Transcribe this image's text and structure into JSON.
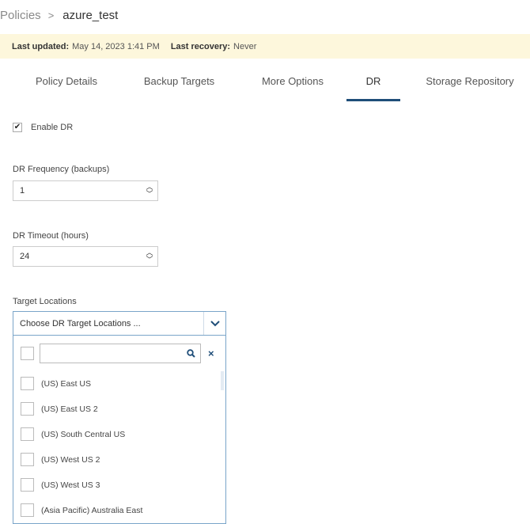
{
  "breadcrumb": {
    "parent": "Policies",
    "separator": ">",
    "current": "azure_test"
  },
  "banner": {
    "last_updated_label": "Last updated:",
    "last_updated_value": "May 14, 2023 1:41 PM",
    "last_recovery_label": "Last recovery:",
    "last_recovery_value": "Never"
  },
  "tabs": [
    {
      "label": "Policy Details",
      "active": false
    },
    {
      "label": "Backup Targets",
      "active": false
    },
    {
      "label": "More Options",
      "active": false
    },
    {
      "label": "DR",
      "active": true
    },
    {
      "label": "Storage Repository",
      "active": false
    }
  ],
  "enable_dr": {
    "label": "Enable DR",
    "checked": true,
    "check_mark": "✔"
  },
  "dr_frequency": {
    "label": "DR Frequency (backups)",
    "value": "1"
  },
  "dr_timeout": {
    "label": "DR Timeout (hours)",
    "value": "24"
  },
  "spin_glyphs": {
    "up": "︿",
    "down": "﹀"
  },
  "target_locations": {
    "label": "Target Locations",
    "placeholder": "Choose DR Target Locations ...",
    "clear_label": "×",
    "options": [
      "(US) East US",
      "(US) East US 2",
      "(US) South Central US",
      "(US) West US 2",
      "(US) West US 3",
      "(Asia Pacific) Australia East"
    ]
  },
  "colors": {
    "accent": "#1f4e79",
    "banner_bg": "#fdf7dc",
    "select_border": "#7aa5c9"
  }
}
